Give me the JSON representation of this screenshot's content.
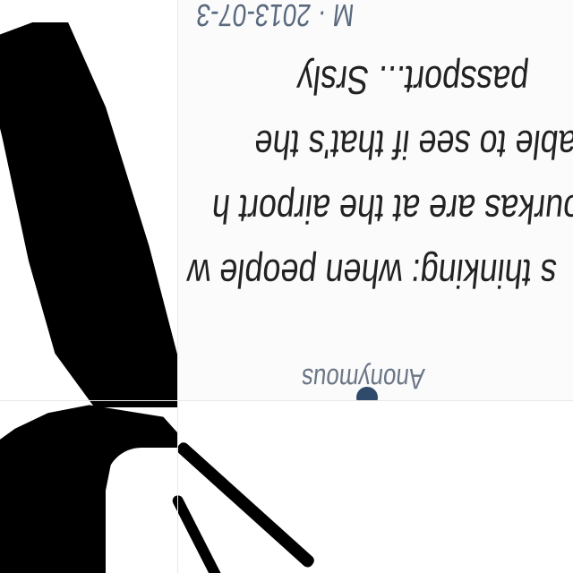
{
  "comment": {
    "meta": "M · 2013-07-3",
    "lines": [
      "passport... Srsly",
      "rity able to see if that's the",
      "ourkas are at the airport h",
      "s thinking: when people w"
    ],
    "author": "Anonymous"
  }
}
